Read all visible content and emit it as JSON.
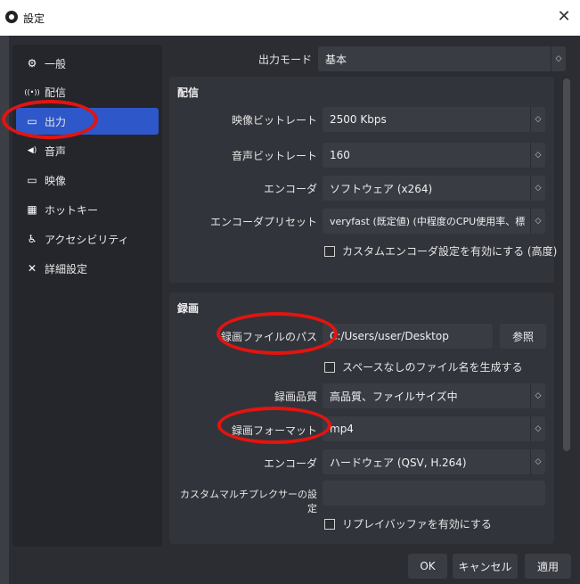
{
  "window": {
    "title": "設定",
    "close_glyph": "✕"
  },
  "sidebar": {
    "items": [
      {
        "label": "一般",
        "icon": "gear-icon",
        "glyph": "⚙"
      },
      {
        "label": "配信",
        "icon": "broadcast-icon",
        "glyph": "((•))"
      },
      {
        "label": "出力",
        "icon": "output-icon",
        "glyph": "▭"
      },
      {
        "label": "音声",
        "icon": "speaker-icon",
        "glyph": "◀)"
      },
      {
        "label": "映像",
        "icon": "monitor-icon",
        "glyph": "▭"
      },
      {
        "label": "ホットキー",
        "icon": "keyboard-icon",
        "glyph": "▦"
      },
      {
        "label": "アクセシビリティ",
        "icon": "accessibility-icon",
        "glyph": "♿"
      },
      {
        "label": "詳細設定",
        "icon": "tools-icon",
        "glyph": "✕"
      }
    ],
    "active_index": 2
  },
  "output_mode": {
    "label": "出力モード",
    "value": "基本"
  },
  "streaming": {
    "title": "配信",
    "video_bitrate": {
      "label": "映像ビットレート",
      "value": "2500 Kbps"
    },
    "audio_bitrate": {
      "label": "音声ビットレート",
      "value": "160"
    },
    "encoder": {
      "label": "エンコーダ",
      "value": "ソフトウェア (x264)"
    },
    "encoder_preset": {
      "label": "エンコーダプリセット",
      "value": "veryfast (既定値) (中程度のCPU使用率、標"
    },
    "custom_encoder_checkbox": "カスタムエンコーダ設定を有効にする (高度)"
  },
  "recording": {
    "title": "録画",
    "path": {
      "label": "録画ファイルのパス",
      "value": "C:/Users/user/Desktop"
    },
    "browse_button": "参照",
    "no_space_checkbox": "スペースなしのファイル名を生成する",
    "quality": {
      "label": "録画品質",
      "value": "高品質、ファイルサイズ中"
    },
    "format": {
      "label": "録画フォーマット",
      "value": "mp4"
    },
    "encoder": {
      "label": "エンコーダ",
      "value": "ハードウェア (QSV, H.264)"
    },
    "muxer": {
      "label": "カスタムマルチプレクサーの設定",
      "value": ""
    },
    "replay_buffer_checkbox": "リプレイバッファを有効にする"
  },
  "footer": {
    "ok": "OK",
    "cancel": "キャンセル",
    "apply": "適用"
  },
  "colors": {
    "annotation": "#e3140f",
    "active": "#2e57c9",
    "background": "#2b2d33"
  }
}
